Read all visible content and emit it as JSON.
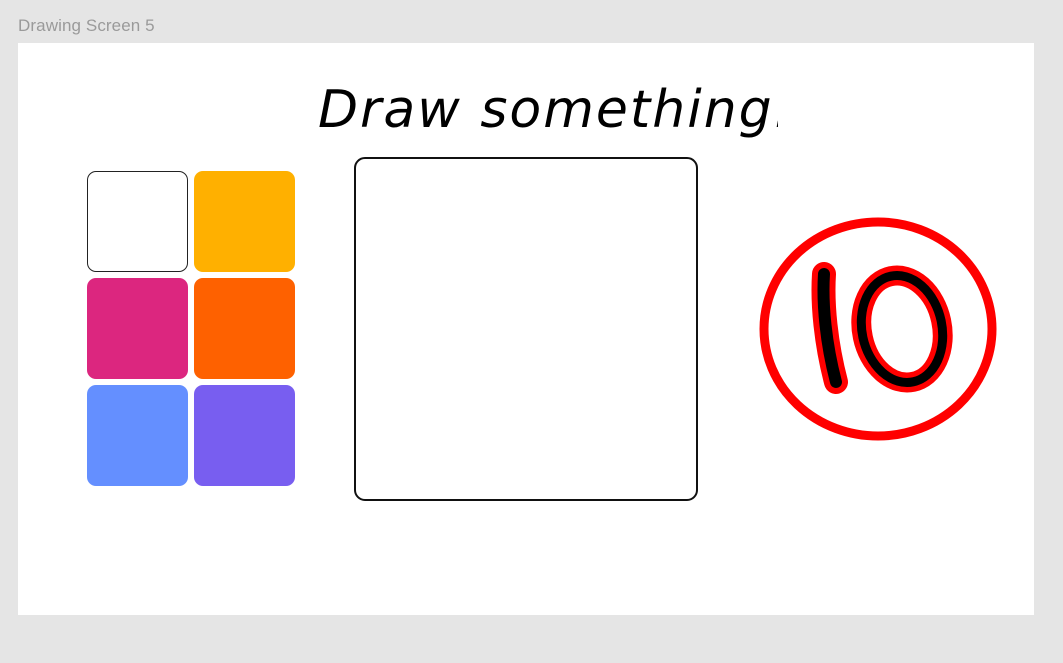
{
  "frame": {
    "label": "Drawing Screen 5"
  },
  "prompt": {
    "title": "Draw something..."
  },
  "palette": {
    "colors": [
      {
        "name": "white",
        "hex": "#ffffff"
      },
      {
        "name": "amber",
        "hex": "#ffb000"
      },
      {
        "name": "magenta",
        "hex": "#dc267f"
      },
      {
        "name": "orange",
        "hex": "#fe6100"
      },
      {
        "name": "blue",
        "hex": "#648fff"
      },
      {
        "name": "violet",
        "hex": "#785ef0"
      }
    ]
  },
  "canvas": {
    "border_color": "#111111"
  },
  "timer": {
    "value": "10",
    "ring_color": "#ff0000"
  }
}
